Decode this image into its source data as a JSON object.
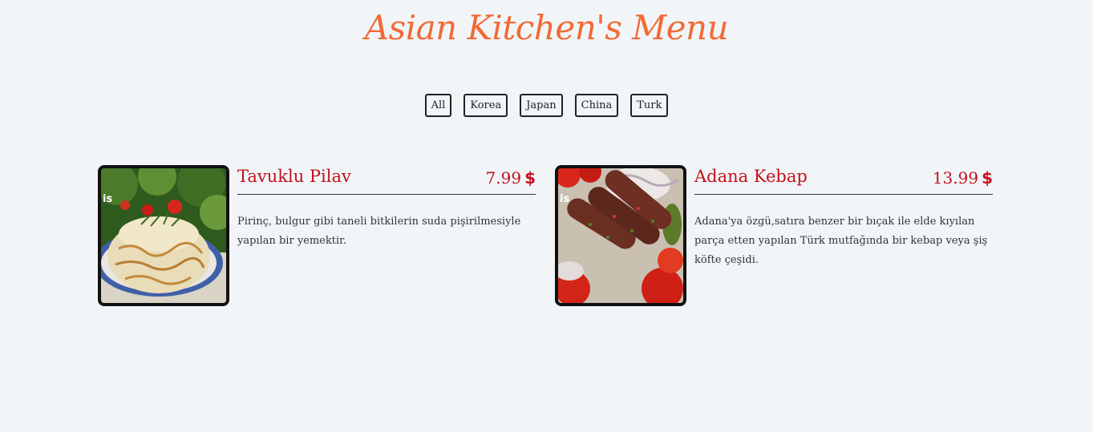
{
  "page": {
    "title": "Asian Kitchen's Menu"
  },
  "filters": [
    {
      "label": "All"
    },
    {
      "label": "Korea"
    },
    {
      "label": "Japan"
    },
    {
      "label": "China"
    },
    {
      "label": "Turk"
    }
  ],
  "menu": [
    {
      "name": "Tavuklu Pilav",
      "price": "7.99",
      "currency": "$",
      "description": "Pirinç, bulgur gibi taneli bitkilerin suda pişirilmesiyle yapılan bir yemektir."
    },
    {
      "name": "Adana Kebap",
      "price": "13.99",
      "currency": "$",
      "description": "Adana'ya özgü,satıra benzer bir bıçak ile elde kıyılan parça etten yapılan Türk mutfağında bir kebap veya şiş köfte çeşidi."
    }
  ],
  "colors": {
    "background": "#f1f5f8",
    "title": "#f26a35",
    "accent": "#c4101c"
  }
}
